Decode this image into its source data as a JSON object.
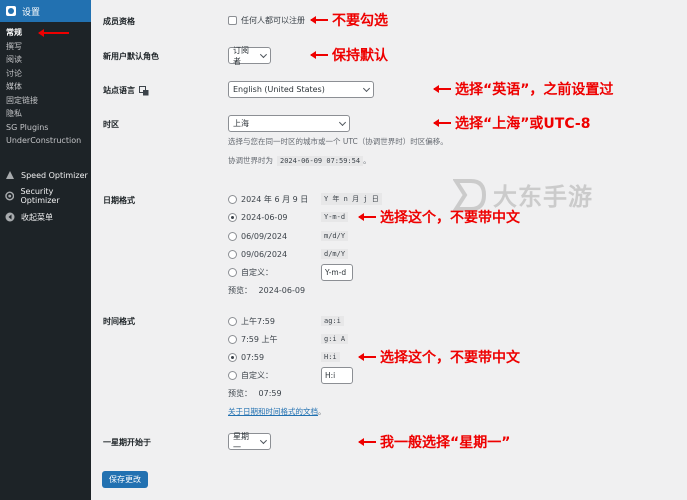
{
  "sidebar": {
    "header": "设置",
    "items": [
      {
        "label": "常规",
        "active": true
      },
      {
        "label": "撰写"
      },
      {
        "label": "阅读"
      },
      {
        "label": "讨论"
      },
      {
        "label": "媒体"
      },
      {
        "label": "固定链接"
      },
      {
        "label": "隐私"
      },
      {
        "label": "SG Plugins"
      },
      {
        "label": "UnderConstruction"
      }
    ],
    "plugins": [
      {
        "label": "Speed Optimizer",
        "icon": "speed-icon"
      },
      {
        "label": "Security Optimizer",
        "icon": "security-icon"
      },
      {
        "label": "收起菜单",
        "icon": "collapse-icon"
      }
    ]
  },
  "settings": {
    "membership": {
      "label": "成员资格",
      "checkbox_label": "任何人都可以注册"
    },
    "default_role": {
      "label": "新用户默认角色",
      "value": "订阅者"
    },
    "language": {
      "label": "站点语言",
      "value": "English (United States)"
    },
    "timezone": {
      "label": "时区",
      "value": "上海",
      "help": "选择与您在同一时区的城市或一个 UTC（协调世界时）时区偏移。",
      "utc_label": "协调世界时为",
      "utc_value": "2024-06-09 07:59:54",
      "utc_suffix": "。"
    },
    "date_format": {
      "label": "日期格式",
      "options": [
        {
          "text": "2024 年 6 月 9 日",
          "code": "Y 年 n 月 j 日",
          "checked": false
        },
        {
          "text": "2024-06-09",
          "code": "Y-m-d",
          "checked": true
        },
        {
          "text": "06/09/2024",
          "code": "m/d/Y",
          "checked": false
        },
        {
          "text": "09/06/2024",
          "code": "d/m/Y",
          "checked": false
        }
      ],
      "custom_label": "自定义：",
      "custom_value": "Y-m-d",
      "preview_label": "预览：",
      "preview_value": "2024-06-09"
    },
    "time_format": {
      "label": "时间格式",
      "options": [
        {
          "text": "上午7:59",
          "code": "ag:i",
          "checked": false
        },
        {
          "text": "7:59 上午",
          "code": "g:i A",
          "checked": false
        },
        {
          "text": "07:59",
          "code": "H:i",
          "checked": true
        }
      ],
      "custom_label": "自定义：",
      "custom_value": "H:i",
      "preview_label": "预览：",
      "preview_value": "07:59",
      "doc_link": "关于日期和时间格式的文档",
      "doc_link_suffix": "。"
    },
    "week_start": {
      "label": "一星期开始于",
      "value": "星期一"
    },
    "save_button": "保存更改"
  },
  "annotations": {
    "membership": "不要勾选",
    "role": "保持默认",
    "language": "选择“英语”，之前设置过",
    "timezone": "选择“上海”或UTC-8",
    "date": "选择这个，不要带中文",
    "time": "选择这个，不要带中文",
    "week": "我一般选择“星期一”"
  },
  "watermark": "大东手游",
  "colors": {
    "sidebar_bg": "#1d2327",
    "accent": "#2271b1",
    "annotation": "#e00000"
  }
}
